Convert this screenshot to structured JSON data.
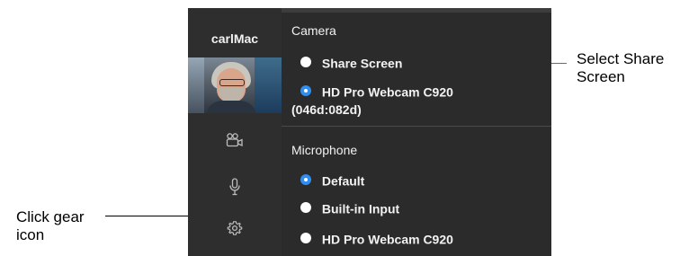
{
  "sidebar": {
    "user_name": "carlMac",
    "icons": [
      "video-camera-icon",
      "microphone-icon",
      "gear-icon"
    ]
  },
  "camera": {
    "title": "Camera",
    "options": [
      {
        "label": "Share Screen",
        "selected": false
      },
      {
        "label": "HD Pro Webcam C920",
        "selected": true
      }
    ],
    "webcam_id": "(046d:082d)"
  },
  "microphone": {
    "title": "Microphone",
    "options": [
      {
        "label": "Default",
        "selected": true
      },
      {
        "label": "Built-in Input",
        "selected": false
      },
      {
        "label": "HD Pro Webcam C920",
        "selected": false
      }
    ]
  },
  "annotations": {
    "gear": "Click gear icon",
    "share": "Select Share Screen"
  },
  "colors": {
    "panel_bg": "#2b2b2b",
    "sidebar_bg": "#2e2e2e",
    "selected_radio": "#2f8ef0",
    "text": "#f2f2f2"
  }
}
